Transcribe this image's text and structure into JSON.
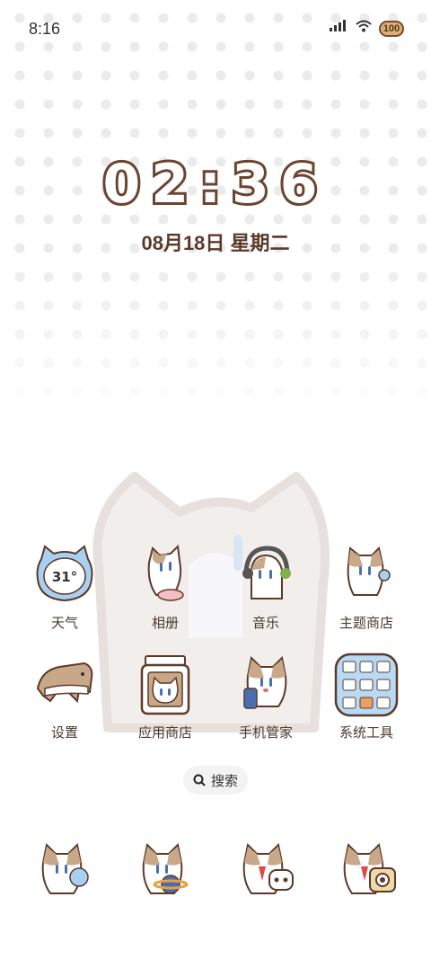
{
  "status_bar": {
    "time": "8:16",
    "battery": "100"
  },
  "clock": {
    "time": "02:36",
    "date": "08月18日 星期二"
  },
  "apps": [
    {
      "label": "天气",
      "temp": "31°"
    },
    {
      "label": "相册"
    },
    {
      "label": "音乐"
    },
    {
      "label": "主题商店"
    },
    {
      "label": "设置"
    },
    {
      "label": "应用商店"
    },
    {
      "label": "手机管家"
    },
    {
      "label": "系统工具"
    }
  ],
  "search": {
    "label": "搜索"
  },
  "colors": {
    "brown": "#6b4430",
    "blue": "#a8d0f0",
    "tan": "#c8a888"
  }
}
